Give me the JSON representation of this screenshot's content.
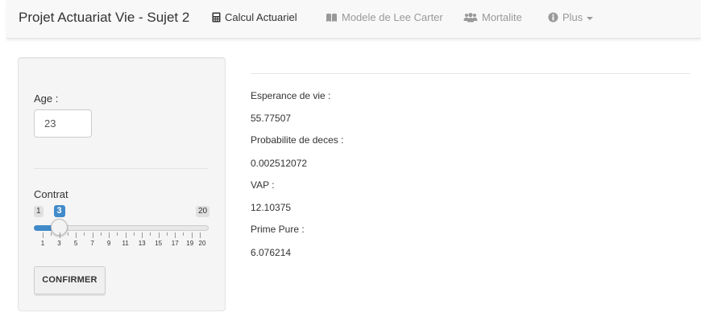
{
  "navbar": {
    "title": "Projet Actuariat Vie - Sujet 2",
    "items": [
      {
        "label": "Calcul Actuariel",
        "icon": "calculator-icon",
        "active": true
      },
      {
        "label": "Modele de Lee Carter",
        "icon": "book-icon",
        "active": false
      },
      {
        "label": "Mortalite",
        "icon": "users-icon",
        "active": false
      },
      {
        "label": "Plus",
        "icon": "info-circle-icon",
        "active": false
      }
    ]
  },
  "sidebar": {
    "age_label": "Age :",
    "age_value": "23",
    "contrat_label": "Contrat",
    "slider": {
      "min": "1",
      "max": "20",
      "value": "3",
      "tick_labels": [
        "1",
        "3",
        "5",
        "7",
        "9",
        "11",
        "13",
        "15",
        "17",
        "19",
        "20"
      ]
    },
    "confirm_label": "CONFIRMER"
  },
  "results": {
    "esperance_label": "Esperance de vie :",
    "esperance_value": "55.77507",
    "proba_label": "Probabilite de deces :",
    "proba_value": "0.002512072",
    "vap_label": "VAP :",
    "vap_value": "12.10375",
    "prime_label": "Prime Pure :",
    "prime_value": "6.076214"
  },
  "colors": {
    "accent": "#428bca",
    "navbar_bg": "#f8f8f8",
    "panel_bg": "#f5f5f5"
  }
}
